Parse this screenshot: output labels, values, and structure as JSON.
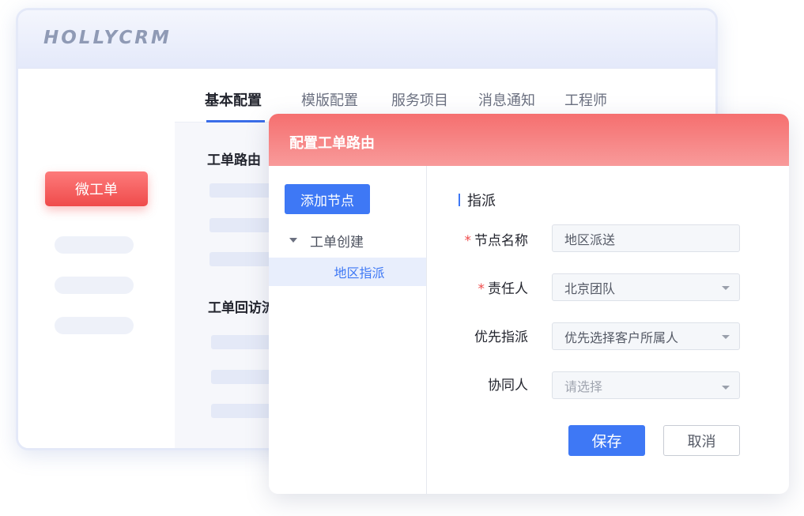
{
  "brand": {
    "logo_text": "HOLLYCRM"
  },
  "sidebar": {
    "active_item_label": "微工单"
  },
  "tabs": [
    {
      "label": "基本配置"
    },
    {
      "label": "模版配置"
    },
    {
      "label": "服务项目"
    },
    {
      "label": "消息通知"
    },
    {
      "label": "工程师"
    }
  ],
  "main": {
    "section_1_title": "工单路由",
    "section_2_title": "工单回访流"
  },
  "dialog": {
    "title": "配置工单路由",
    "add_node_label": "添加节点",
    "tree": {
      "root_label": "工单创建",
      "child_label": "地区指派"
    },
    "panel_title": "指派",
    "form": {
      "node_name": {
        "label": "节点名称",
        "value": "地区派送",
        "required": true
      },
      "owner": {
        "label": "责任人",
        "value": "北京团队",
        "required": true
      },
      "priority": {
        "label": "优先指派",
        "value": "优先选择客户所属人"
      },
      "collaborator": {
        "label": "协同人",
        "placeholder": "请选择"
      }
    },
    "save_label": "保存",
    "cancel_label": "取消"
  },
  "colors": {
    "accent_blue": "#3e78f5",
    "brand_red": "#ef4b4b",
    "required_red": "#ef4b4b"
  },
  "icons": [
    "caret-down-icon",
    "chevron-down-icon"
  ]
}
